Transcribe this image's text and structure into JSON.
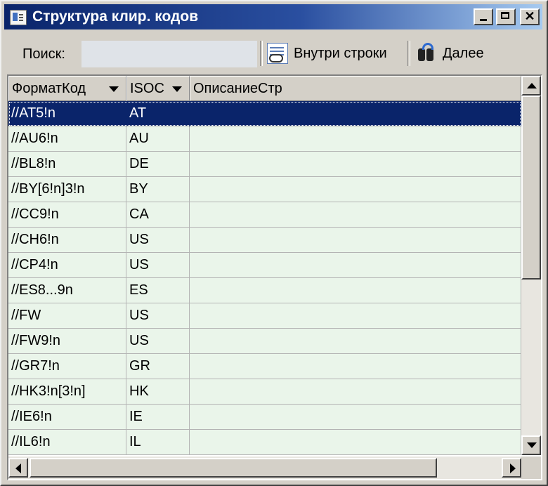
{
  "window": {
    "title": "Структура клир. кодов",
    "icon": "book-icon",
    "controls": [
      "minimize",
      "maximize",
      "close"
    ]
  },
  "toolbar": {
    "search_label": "Поиск:",
    "search_value": "",
    "in_row_label": "Внутри строки",
    "in_row_icon": "search-in-row-icon",
    "next_label": "Далее",
    "next_icon": "binoculars-icon"
  },
  "table": {
    "columns": [
      "ФорматКод",
      "ISOC",
      "ОписаниеСтр"
    ],
    "selected_row": 0,
    "rows": [
      {
        "format": "//AT5!n",
        "iso": "AT",
        "desc": ""
      },
      {
        "format": "//AU6!n",
        "iso": "AU",
        "desc": ""
      },
      {
        "format": "//BL8!n",
        "iso": "DE",
        "desc": ""
      },
      {
        "format": "//BY[6!n]3!n",
        "iso": "BY",
        "desc": ""
      },
      {
        "format": "//CC9!n",
        "iso": "CA",
        "desc": ""
      },
      {
        "format": "//CH6!n",
        "iso": "US",
        "desc": ""
      },
      {
        "format": "//CP4!n",
        "iso": "US",
        "desc": ""
      },
      {
        "format": "//ES8...9n",
        "iso": "ES",
        "desc": ""
      },
      {
        "format": "//FW",
        "iso": "US",
        "desc": ""
      },
      {
        "format": "//FW9!n",
        "iso": "US",
        "desc": ""
      },
      {
        "format": "//GR7!n",
        "iso": "GR",
        "desc": ""
      },
      {
        "format": "//HK3!n[3!n]",
        "iso": "HK",
        "desc": ""
      },
      {
        "format": "//IE6!n",
        "iso": "IE",
        "desc": ""
      },
      {
        "format": "//IL6!n",
        "iso": "IL",
        "desc": ""
      }
    ]
  },
  "colors": {
    "titlebar": "#0a246a",
    "selection": "#0a246a",
    "row_background": "#eaf5ea",
    "window": "#d4d0c8"
  }
}
